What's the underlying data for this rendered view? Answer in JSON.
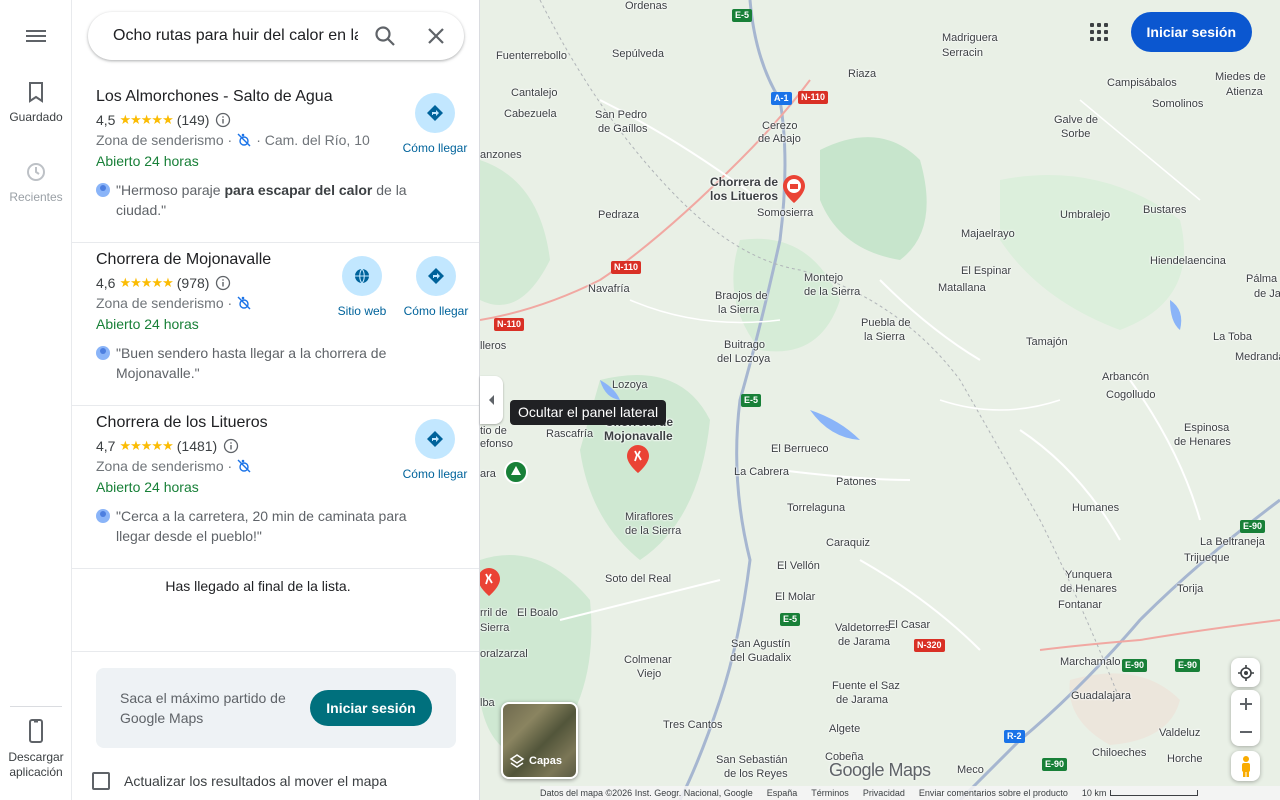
{
  "rail": {
    "menu_icon": "hamburger-menu-icon",
    "saved_label": "Guardado",
    "recent_label": "Recientes",
    "download_label": "Descargar aplicación"
  },
  "search": {
    "query": "Ocho rutas para huir del calor en la"
  },
  "results": [
    {
      "title": "Los Almorchones - Salto de Agua",
      "rating": "4,5",
      "stars": "★★★★★",
      "reviews": "(149)",
      "category": "Zona de senderismo ·",
      "address": "· Cam. del Río, 10",
      "hours": "Abierto 24 horas",
      "review_pre": "\"Hermoso paraje ",
      "review_bold": "para escapar del calor",
      "review_post": " de la ciudad.\"",
      "directions_label": "Cómo llegar"
    },
    {
      "title": "Chorrera de Mojonavalle",
      "rating": "4,6",
      "stars": "★★★★★",
      "reviews": "(978)",
      "category": "Zona de senderismo ·",
      "hours": "Abierto 24 horas",
      "review": "\"Buen sendero hasta llegar a la chorrera de Mojonavalle.\"",
      "website_label": "Sitio web",
      "directions_label": "Cómo llegar"
    },
    {
      "title": "Chorrera de los Litueros",
      "rating": "4,7",
      "stars": "★★★★★",
      "reviews": "(1481)",
      "category": "Zona de senderismo ·",
      "hours": "Abierto 24 horas",
      "review": "\"Cerca a la carretera, 20 min de caminata para llegar desde el pueblo!\"",
      "directions_label": "Cómo llegar"
    }
  ],
  "end_of_list": "Has llegado al final de la lista.",
  "promo": {
    "text": "Saca el máximo partido de Google Maps",
    "button": "Iniciar sesión"
  },
  "update_checkbox_label": "Actualizar los resultados al mover el mapa",
  "map": {
    "tooltip": "Ocultar el panel lateral",
    "signin": "Iniciar sesión",
    "layers_label": "Capas",
    "logo": "Google Maps",
    "places": [
      "Madriguera",
      "Serracin",
      "Fuenterrebollo",
      "Sepúlveda",
      "Riaza",
      "Campisábalos",
      "Miedes de",
      "Atienza",
      "Somolinos",
      "Cantalejo",
      "San Pedro",
      "de Gaíllos",
      "Cerezo",
      "de Abajo",
      "Galve de",
      "Sorbe",
      "Cabezuela",
      "anzones",
      "Chorrera de",
      "los Litueros",
      "Somosierra",
      "Umbralejo",
      "Bustares",
      "Pedraza",
      "Majaelrayo",
      "Hiendelaencina",
      "Montejo",
      "de la Sierra",
      "El Espinar",
      "Matallana",
      "Pálma",
      "de Jad",
      "Navafría",
      "Braojos de",
      "la Sierra",
      "Puebla de",
      "la Sierra",
      "La Toba",
      "Medranda",
      "Tamajón",
      "lleros",
      "Buitrago",
      "del Lozoya",
      "Arbancón",
      "Cogolludo",
      "Lozoya",
      "Espinosa",
      "de Henares",
      "Rascafría",
      "Chorrera de",
      "Mojonavalle",
      "El Berrueco",
      "La Cabrera",
      "Patones",
      "Miraflores",
      "de la Sierra",
      "Torrelaguna",
      "Humanes",
      "La Beltraneja",
      "Trijueque",
      "Soto del Real",
      "Caraquiz",
      "El Vellón",
      "Yunquera",
      "de Henares",
      "Fontanar",
      "Torija",
      "El Boalo",
      "El Molar",
      "Valdetorres",
      "de Jarama",
      "El Casar",
      "San Agustín",
      "del Guadalix",
      "Colmenar",
      "Viejo",
      "Marchamalo",
      "Fuente el Saz",
      "de Jarama",
      "Guadalajara",
      "Algete",
      "Tres Cantos",
      "Valdeluz",
      "Cobeña",
      "Chiloeches",
      "San Sebastián",
      "de los Reyes",
      "Meco",
      "Horche",
      "Ordenas",
      "ara",
      "rril de",
      "Sierra",
      "oralzarzal",
      "lba",
      "tio de",
      "efonso"
    ],
    "roads": [
      "E-5",
      "A-1",
      "N-110",
      "N-110",
      "N-110",
      "E-5",
      "E-90",
      "E-90",
      "N-320",
      "E-90",
      "R-2",
      "E-90",
      "E-5"
    ],
    "attribution": "Datos del mapa ©2026 Inst. Geogr. Nacional, Google",
    "country": "España",
    "terms": "Términos",
    "privacy": "Privacidad",
    "feedback": "Enviar comentarios sobre el producto",
    "scale": "10 km"
  }
}
